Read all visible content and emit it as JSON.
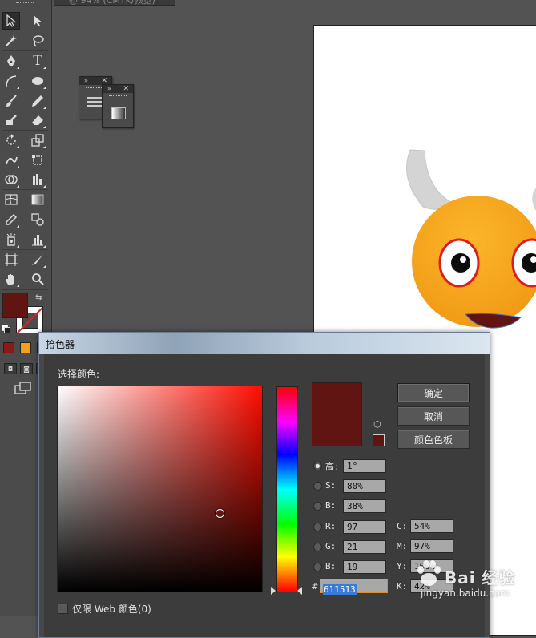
{
  "document": {
    "tab_label": "@ 94% (CMYK/预览)"
  },
  "toolbar": {
    "fill_color": "#611513",
    "swatch_colors": [
      "#8a1a16",
      "#f5a01a",
      "#ffffff"
    ],
    "tools": [
      "selection-tool",
      "direct-selection-tool",
      "magic-wand-tool",
      "lasso-tool",
      "pen-tool",
      "type-tool",
      "arc-tool",
      "ellipse-tool",
      "paintbrush-tool",
      "pencil-tool",
      "blob-brush-tool",
      "eraser-tool",
      "rotate-tool",
      "scale-tool",
      "warp-tool",
      "free-transform-tool",
      "shape-builder-tool",
      "graph-tool",
      "mesh-tool",
      "gradient-tool",
      "eyedropper-tool",
      "blend-tool",
      "symbol-sprayer-tool",
      "column-graph-tool",
      "artboard-tool",
      "slice-tool",
      "hand-tool",
      "zoom-tool"
    ]
  },
  "artwork": {
    "face_color": "#f5a01a",
    "mouth_color": "#611513",
    "horn_color": "#d4d4d4",
    "eye_ring_color": "#e01b1b"
  },
  "dialog": {
    "title": "拾色器",
    "select_color_label": "选择颜色:",
    "current_color": "#611513",
    "ok_button": "确定",
    "cancel_button": "取消",
    "swatches_button": "颜色色板",
    "hsb": [
      {
        "label": "高:",
        "value": "1°",
        "selected": true
      },
      {
        "label": "S:",
        "value": "80%",
        "selected": false
      },
      {
        "label": "B:",
        "value": "38%",
        "selected": false
      }
    ],
    "rgb": [
      {
        "label": "R:",
        "value": "97"
      },
      {
        "label": "G:",
        "value": "21"
      },
      {
        "label": "B:",
        "value": "19"
      }
    ],
    "cmyk": [
      {
        "label": "C:",
        "value": "54%"
      },
      {
        "label": "M:",
        "value": "97%"
      },
      {
        "label": "Y:",
        "value": "100%"
      },
      {
        "label": "K:",
        "value": "42%"
      }
    ],
    "hex_label": "#",
    "hex_value": "611513",
    "web_only_label": "仅限 Web 颜色(0)"
  },
  "watermark": {
    "brand": "Bai 经验",
    "url": "jingyan.baidu.com"
  }
}
